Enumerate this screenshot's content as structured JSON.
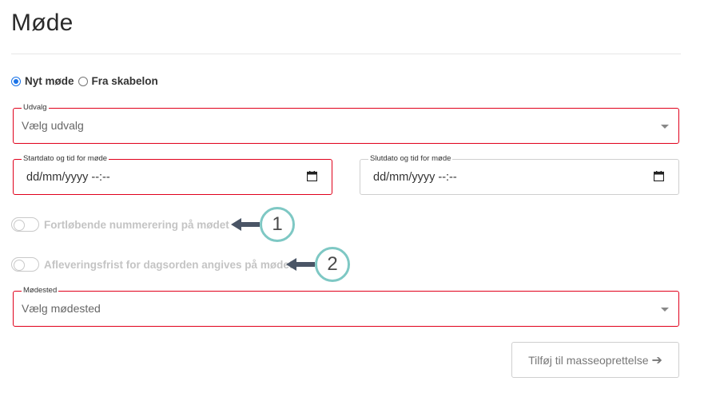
{
  "page": {
    "title": "Møde"
  },
  "meeting_type": {
    "options": [
      {
        "label": "Nyt møde",
        "checked": true
      },
      {
        "label": "Fra skabelon",
        "checked": false
      }
    ]
  },
  "fields": {
    "udvalg": {
      "legend": "Udvalg",
      "placeholder": "Vælg udvalg"
    },
    "start": {
      "legend": "Startdato og tid for møde",
      "value": "dd/mm/yyyy --:--"
    },
    "end": {
      "legend": "Slutdato og tid for møde",
      "value": "dd/mm/yyyy --:--"
    },
    "modested": {
      "legend": "Mødested",
      "placeholder": "Vælg mødested"
    }
  },
  "toggles": [
    {
      "label": "Fortløbende nummerering på mødet",
      "on": false,
      "callout": "1"
    },
    {
      "label": "Afleveringsfrist for dagsorden angives på mødet",
      "on": false,
      "callout": "2"
    }
  ],
  "actions": {
    "add_label": "Tilføj til masseoprettelse",
    "add_icon": "arrow-right-icon"
  },
  "colors": {
    "error_border": "#e0001b",
    "callout_ring": "#7ec8c4",
    "radio_accent": "#1a73e8"
  }
}
